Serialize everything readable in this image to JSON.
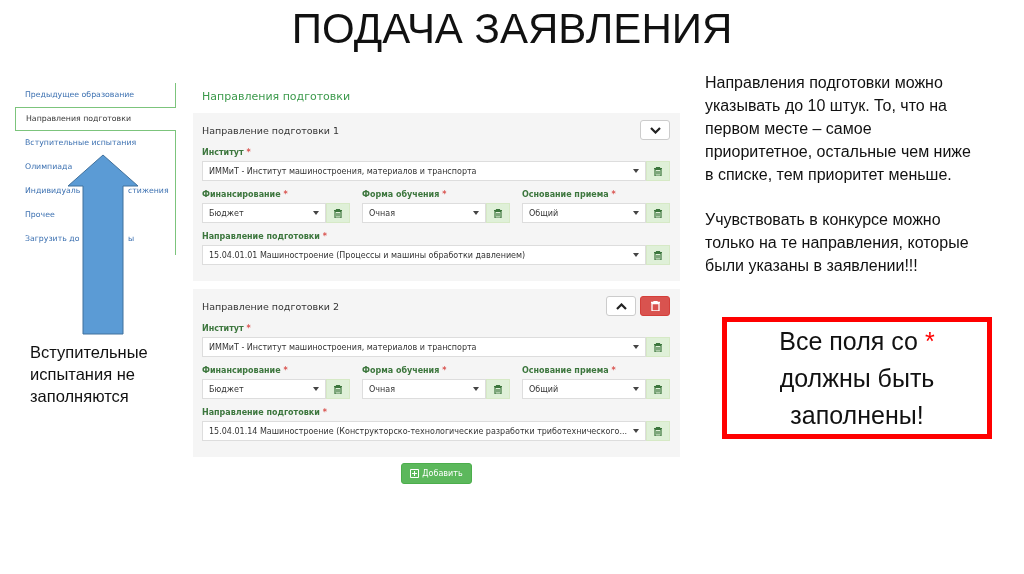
{
  "slide_title": "ПОДАЧА ЗАЯВЛЕНИЯ",
  "sidebar": {
    "items": [
      {
        "label_parts": [
          "Предыдущее образование"
        ],
        "selected": false
      },
      {
        "label_parts": [
          "Направления подготовки"
        ],
        "selected": true
      },
      {
        "label_parts": [
          "Вступительные испытания"
        ],
        "selected": false
      },
      {
        "label_parts": [
          "Олимпиада"
        ],
        "selected": false
      },
      {
        "label_parts": [
          "Индивидуаль",
          "стижения"
        ],
        "selected": false
      },
      {
        "label_parts": [
          "Прочее"
        ],
        "selected": false
      },
      {
        "label_parts": [
          "Загрузить до",
          "ы"
        ],
        "selected": false
      }
    ]
  },
  "arrow_note": "Вступительные испытания не заполняются",
  "form": {
    "heading": "Направления подготовки",
    "directions": [
      {
        "title": "Направление подготовки 1",
        "chevron_up": false,
        "removable": false,
        "rows": [
          [
            {
              "label": "Институт",
              "mark": "*",
              "value": "ИММиТ - Институт машиностроения, материалов и транспорта"
            }
          ],
          [
            {
              "label": "Финансирование",
              "mark": "*",
              "value": "Бюджет"
            },
            {
              "label": "Форма обучения",
              "mark": "*",
              "value": "Очная"
            },
            {
              "label": "Основание приема",
              "mark": "*",
              "value": "Общий"
            }
          ],
          [
            {
              "label": "Направление подготовки",
              "mark": "*",
              "value": "15.04.01.01 Машиностроение (Процессы и машины обработки давлением)"
            }
          ]
        ]
      },
      {
        "title": "Направление подготовки 2",
        "chevron_up": true,
        "removable": true,
        "rows": [
          [
            {
              "label": "Институт",
              "mark": "*",
              "value": "ИММиТ - Институт машиностроения, материалов и транспорта"
            }
          ],
          [
            {
              "label": "Финансирование",
              "mark": "*",
              "value": "Бюджет"
            },
            {
              "label": "Форма обучения",
              "mark": "*",
              "value": "Очная"
            },
            {
              "label": "Основание приема",
              "mark": "*",
              "value": "Общий"
            }
          ],
          [
            {
              "label": "Направление подготовки",
              "mark": "*",
              "value": "15.04.01.14 Машиностроение (Конструкторско-технологические разработки триботехнического..."
            }
          ]
        ]
      }
    ],
    "add_button": "Добавить"
  },
  "notes": [
    "Направления подготовки можно указывать до 10 штук. То, что на первом месте – самое приоритетное, остальные чем ниже в списке, тем приоритет меньше.",
    "Учувствовать в конкурсе можно только на те направления, которые были указаны в заявлении!!!"
  ],
  "callout": {
    "before": "Все поля со",
    "star": "*",
    "after": "должны быть заполнены!"
  }
}
